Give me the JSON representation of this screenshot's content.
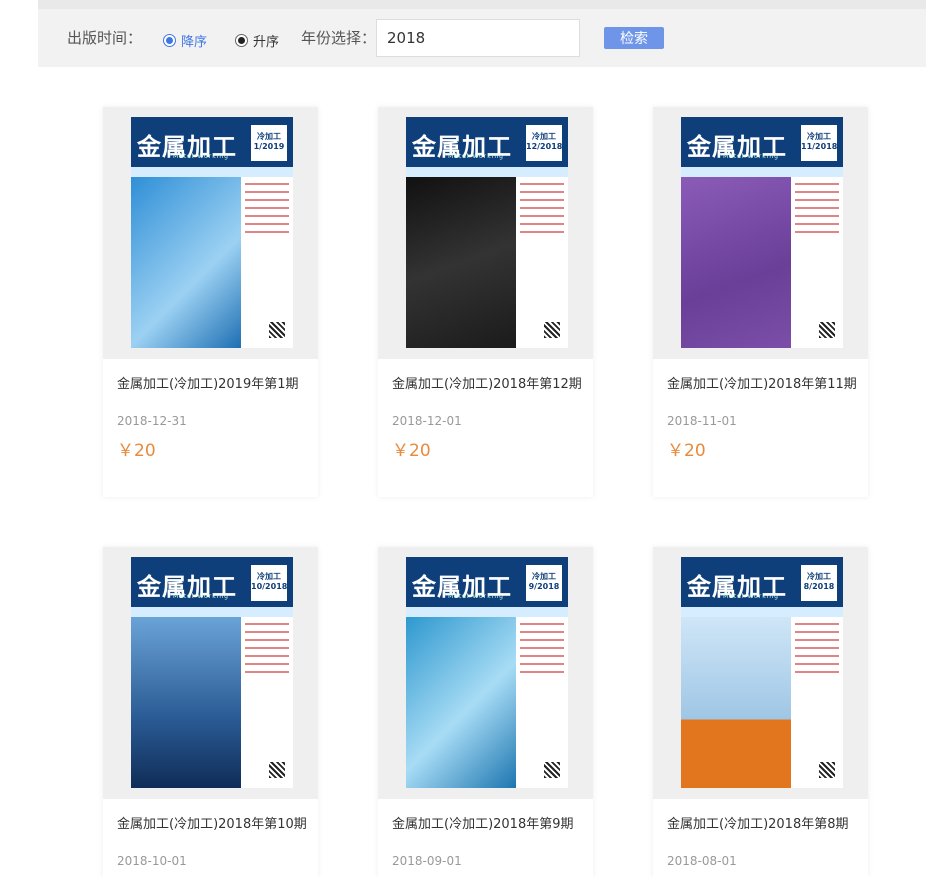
{
  "filter": {
    "publish_label": "出版时间：",
    "desc_label": "降序",
    "asc_label": "升序",
    "year_label": "年份选择：",
    "year_value": "2018",
    "search_label": "检索"
  },
  "cover": {
    "logo_text": "金属加工",
    "subtitle": "Metal Working",
    "edition": "冷加工"
  },
  "cards": [
    {
      "title": "金属加工(冷加工)2019年第1期",
      "date": "2018-12-31",
      "price": "￥20",
      "issue": "1/2019",
      "art_color": "#2f8fd6"
    },
    {
      "title": "金属加工(冷加工)2018年第12期",
      "date": "2018-12-01",
      "price": "￥20",
      "issue": "12/2018",
      "art_color": "#1b1b1b"
    },
    {
      "title": "金属加工(冷加工)2018年第11期",
      "date": "2018-11-01",
      "price": "￥20",
      "issue": "11/2018",
      "art_color": "#7b4fa8"
    },
    {
      "title": "金属加工(冷加工)2018年第10期",
      "date": "2018-10-01",
      "price": "",
      "issue": "10/2018",
      "art_color": "#2a5a93"
    },
    {
      "title": "金属加工(冷加工)2018年第9期",
      "date": "2018-09-01",
      "price": "",
      "issue": "9/2018",
      "art_color": "#2e98cf"
    },
    {
      "title": "金属加工(冷加工)2018年第8期",
      "date": "2018-08-01",
      "price": "",
      "issue": "8/2018",
      "art_color": "#e2761f"
    }
  ]
}
